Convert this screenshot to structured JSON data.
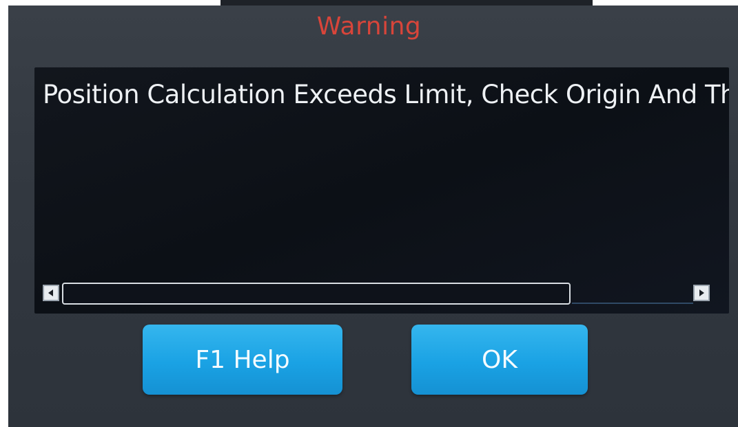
{
  "dialog": {
    "title": "Warning",
    "message": "Position Calculation Exceeds Limit, Check Origin And Th"
  },
  "scrollbar": {
    "left_arrow_icon": "scroll-left-arrow-icon",
    "right_arrow_icon": "scroll-right-arrow-icon",
    "visible_fraction": 0.75,
    "position_fraction": 0.0
  },
  "buttons": {
    "help_label": "F1 Help",
    "ok_label": "OK"
  },
  "colors": {
    "title": "#d8453a",
    "panel_background": "#0c1016",
    "button": "#1aa2e4",
    "button_text": "#f4fbff"
  }
}
